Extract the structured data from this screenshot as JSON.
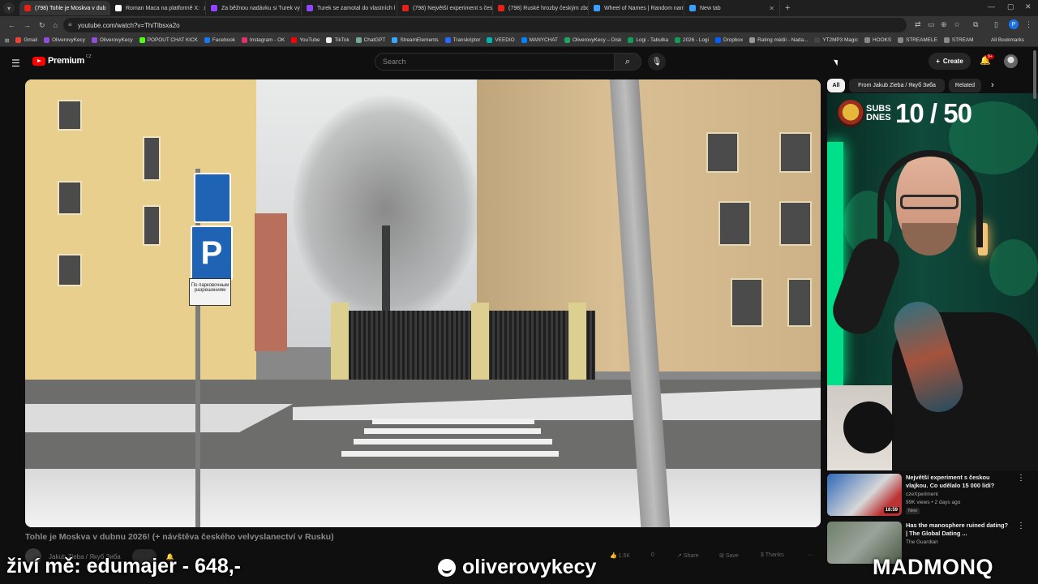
{
  "browser": {
    "tabs": [
      {
        "label": "(798) Tohle je Moskva v dub",
        "type": "yt",
        "active": true
      },
      {
        "label": "Roman Maca na platformě X: ",
        "type": "x"
      },
      {
        "label": "Za běžnou nadávku si Turek vy",
        "type": "tw"
      },
      {
        "label": "Turek se zamotal do vlastních l",
        "type": "tw"
      },
      {
        "label": "(798) Největší experiment s čes",
        "type": "yt"
      },
      {
        "label": "(798) Ruské hrozby českým zbo",
        "type": "yt"
      },
      {
        "label": "Wheel of Names | Random nam",
        "type": "misc"
      },
      {
        "label": "New tab",
        "type": "misc"
      }
    ],
    "url": "youtube.com/watch?v=ThiTlbsxa2o",
    "profile_initial": "P",
    "bookmarks": [
      "Gmail",
      "OliverovyKecy",
      "OliverovyKecy",
      "POPOUT CHAT KICK",
      "Facebook",
      "Instagram - OK",
      "YouTube",
      "TikTok",
      "ChatGPT",
      "StreamElements",
      "Transkriptor",
      "VEEDIO",
      "MANYCHAT",
      "OliverovyKecy – Disk",
      "Logi - Tabulka",
      "2026 - Logi",
      "Dropbox",
      "Rating médií - Nada...",
      "YT2MP3 Magic",
      "HOOKS",
      "STREAMELE",
      "STREAM"
    ],
    "all_bookmarks": "All Bookmarks"
  },
  "youtube": {
    "logo": "Premium",
    "logo_country": "CZ",
    "search_placeholder": "Search",
    "create_label": "Create",
    "notif_count": "9+",
    "video_title": "Tohle je Moskva v dubnu 2026! (+ návštěva českého velvyslanectví v Rusku)",
    "channel": "Jakub Zieba / Якуб Зиба",
    "actions": {
      "likes": "1.5K",
      "dislike": "0",
      "share": "Share",
      "save": "Save",
      "thanks": "Thanks",
      "more": "···"
    },
    "sign_text": "По парковочным разрешениям",
    "sign_p": "P",
    "chips": [
      "All",
      "From Jakub Zieba / Якуб Зиба",
      "Related"
    ],
    "recommendations": [
      {
        "title": "Největší experiment s českou vlajkou. Co udělalo 15 000 lidí?",
        "channel": "czeXperiment",
        "meta": "99K views • 2 days ago",
        "badge": "New",
        "duration": "18:59"
      },
      {
        "title": "Has the manosphere ruined dating? | The Global Dating ...",
        "channel": "The Guardian",
        "meta": "",
        "badge": "",
        "duration": ""
      }
    ]
  },
  "stream": {
    "subs_label": "SUBS DNES",
    "subs_count": "10 / 50",
    "donor": "živí mě: edumajer - 648,-",
    "handle": "oliverovykecy",
    "brand": "MADMONQ"
  },
  "colors": {
    "accent": "#ff0000",
    "bg": "#0f0f0f",
    "neon": "#00e08a"
  }
}
